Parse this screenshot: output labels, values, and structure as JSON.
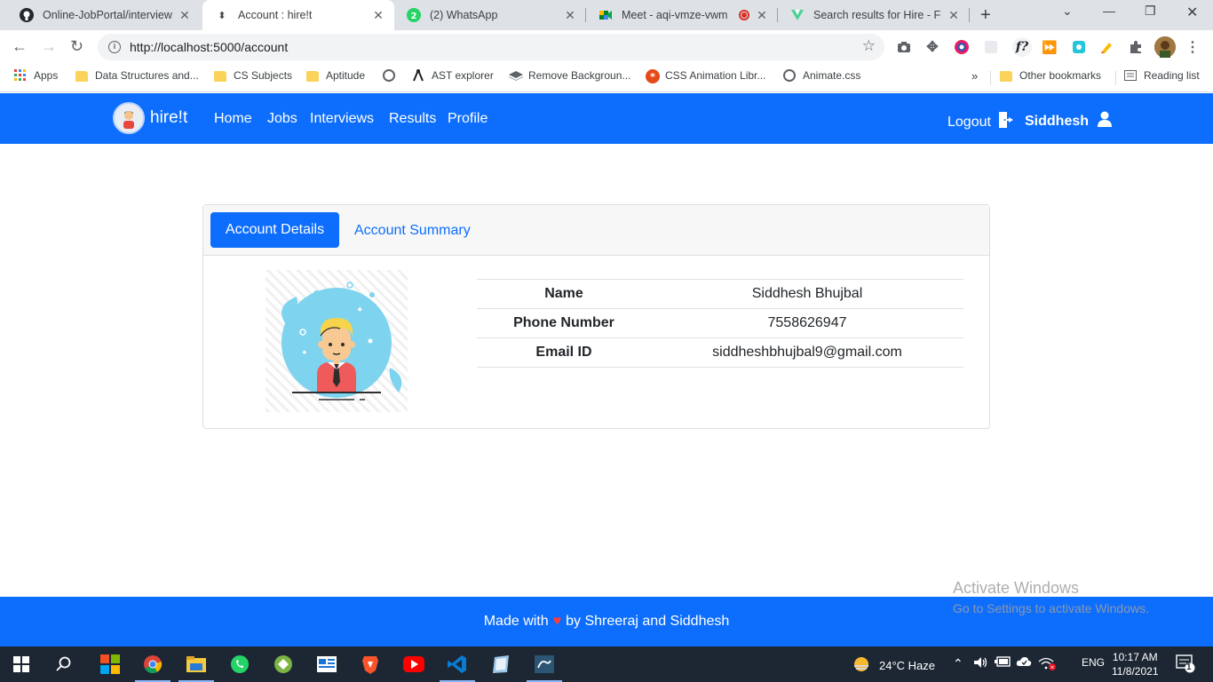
{
  "browser": {
    "tabs": [
      {
        "title": "Online-JobPortal/interview.h",
        "icon": "github-icon"
      },
      {
        "title": "Account : hire!t",
        "icon": "site-icon"
      },
      {
        "title": "(2) WhatsApp",
        "icon": "whatsapp-icon"
      },
      {
        "title": "Meet - aqi-vmze-vwm",
        "icon": "meet-icon"
      },
      {
        "title": "Search results for Hire - Flat",
        "icon": "flaticon-icon"
      }
    ],
    "url": "http://localhost:5000/account",
    "bookmarks": [
      {
        "label": "Apps"
      },
      {
        "label": "Data Structures and..."
      },
      {
        "label": "CS Subjects"
      },
      {
        "label": "Aptitude"
      },
      {
        "label": ""
      },
      {
        "label": "AST explorer"
      },
      {
        "label": "Remove Backgroun..."
      },
      {
        "label": "CSS Animation Libr..."
      },
      {
        "label": "Animate.css"
      }
    ],
    "bookmarks_overflow": "»",
    "other_bookmarks": "Other bookmarks",
    "reading_list": "Reading list"
  },
  "site": {
    "brand": "hire!t",
    "nav": [
      "Home",
      "Jobs",
      "Interviews",
      "Results",
      "Profile"
    ],
    "logout": "Logout",
    "username": "Siddhesh",
    "accent_color": "#0d6efd"
  },
  "account": {
    "tabs": {
      "details": "Account Details",
      "summary": "Account Summary"
    },
    "fields": [
      {
        "label": "Name",
        "value": "Siddhesh Bhujbal"
      },
      {
        "label": "Phone Number",
        "value": "7558626947"
      },
      {
        "label": "Email ID",
        "value": "siddheshbhujbal9@gmail.com"
      }
    ]
  },
  "footer": {
    "prefix": "Made with",
    "heart": "♥",
    "suffix": "by Shreeraj and Siddhesh"
  },
  "watermark": {
    "line1": "Activate Windows",
    "line2": "Go to Settings to activate Windows."
  },
  "taskbar": {
    "weather": "24°C  Haze",
    "lang": "ENG",
    "time": "10:17 AM",
    "date": "11/8/2021",
    "notifications": "1"
  }
}
